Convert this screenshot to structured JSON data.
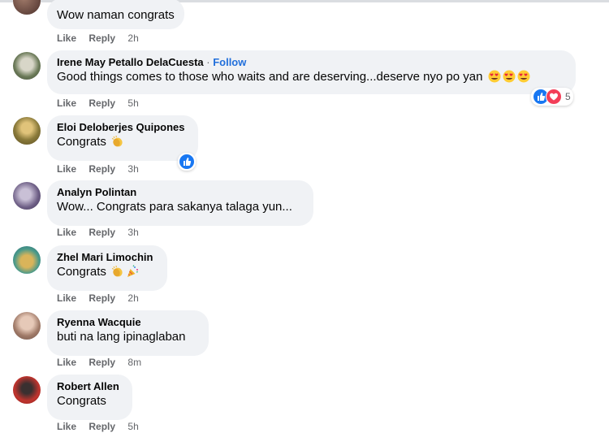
{
  "colors": {
    "bubble": "#f0f2f5",
    "link": "#216fdb",
    "like_blue": "#1877f2",
    "love_red": "#f33e58",
    "muted": "#65676b"
  },
  "comments": [
    {
      "author": "",
      "text": "Wow naman congrats",
      "like": "Like",
      "reply": "Reply",
      "time": "2h"
    },
    {
      "author": "Irene May Petallo DelaCuesta",
      "separator": " · ",
      "follow": "Follow",
      "text": "Good things comes to those who waits and are deserving...deserve nyo po yan",
      "like": "Like",
      "reply": "Reply",
      "time": "5h",
      "reactions": {
        "icons": [
          "like-icon",
          "love-icon"
        ],
        "count": "5"
      }
    },
    {
      "author": "Eloi Deloberjes Quipones",
      "text": "Congrats",
      "like": "Like",
      "reply": "Reply",
      "time": "3h",
      "reactions": {
        "icons": [
          "like-icon"
        ],
        "count": ""
      }
    },
    {
      "author": "Analyn Polintan",
      "text": "Wow... Congrats para sakanya talaga yun...",
      "like": "Like",
      "reply": "Reply",
      "time": "3h"
    },
    {
      "author": "Zhel Mari Limochin",
      "text": "Congrats",
      "like": "Like",
      "reply": "Reply",
      "time": "2h"
    },
    {
      "author": "Ryenna Wacquie",
      "text": "buti na lang ipinaglaban",
      "like": "Like",
      "reply": "Reply",
      "time": "8m"
    },
    {
      "author": "Robert Allen",
      "text": "Congrats",
      "like": "Like",
      "reply": "Reply",
      "time": "5h"
    }
  ]
}
